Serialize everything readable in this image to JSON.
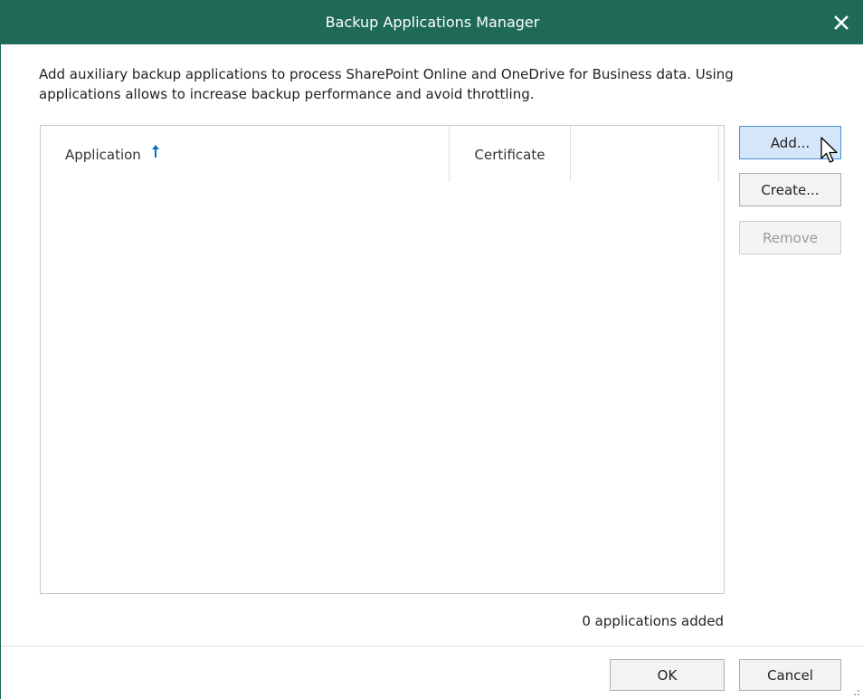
{
  "window": {
    "title": "Backup Applications Manager",
    "close_icon": "close-icon"
  },
  "description": "Add auxiliary backup applications to process SharePoint Online and OneDrive for Business data. Using applications allows to increase backup performance and avoid throttling.",
  "table": {
    "columns": [
      "Application",
      "Certificate",
      ""
    ],
    "sort_icon": "sort-ascending-arrow-icon",
    "rows": []
  },
  "side_buttons": {
    "add": "Add...",
    "create": "Create...",
    "remove": "Remove"
  },
  "status": {
    "count_text": "0 applications added"
  },
  "footer": {
    "ok": "OK",
    "cancel": "Cancel"
  },
  "colors": {
    "titlebar": "#1e6a56",
    "accent": "#0a6ebd",
    "focused_button": "#d4e6f7"
  }
}
